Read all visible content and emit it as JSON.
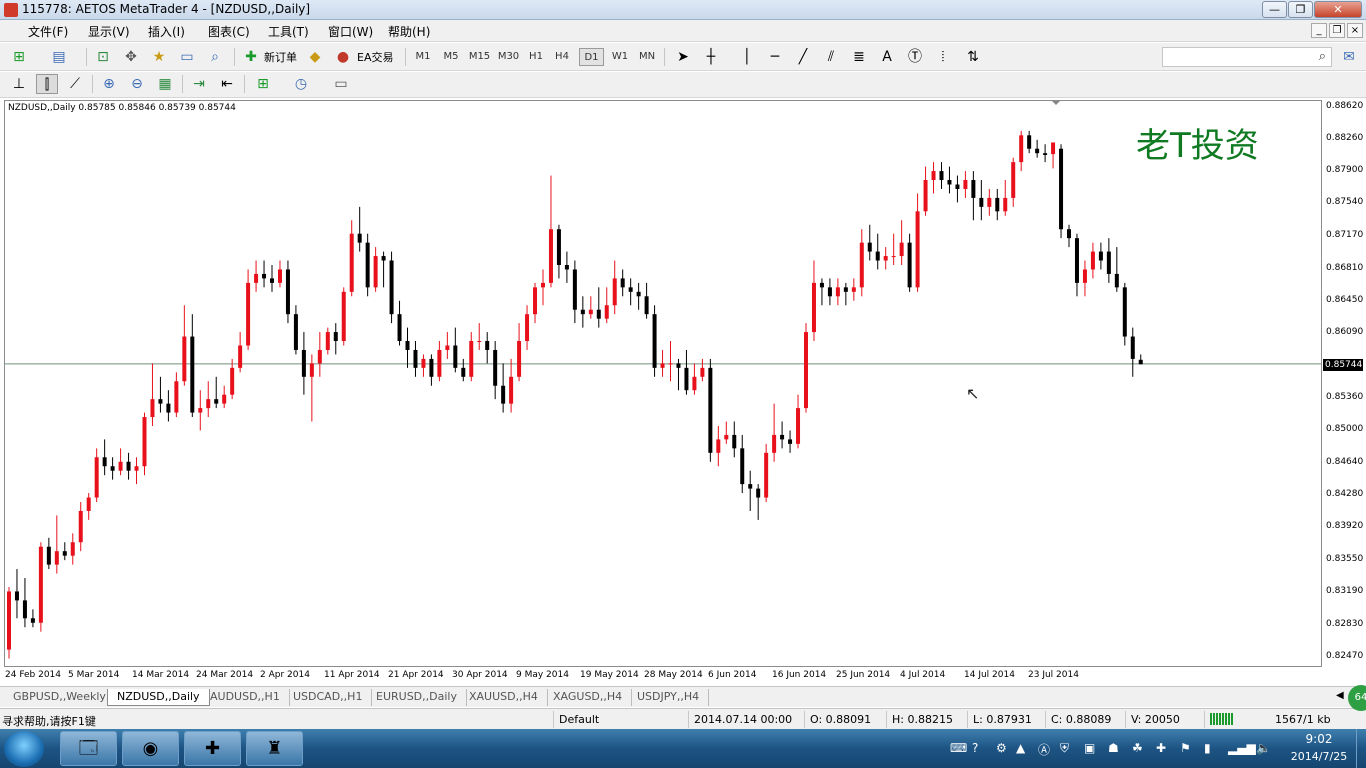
{
  "window": {
    "title": "115778: AETOS MetaTrader 4 - [NZDUSD,,Daily]",
    "min_label": "—",
    "max_label": "❐",
    "close_label": "✕"
  },
  "menu": {
    "items": [
      "文件(F)",
      "显示(V)",
      "插入(I)",
      "图表(C)",
      "工具(T)",
      "窗口(W)",
      "帮助(H)"
    ]
  },
  "toolbar": {
    "new_order_label": "新订单",
    "ea_label": "EA交易",
    "timeframes": [
      "M1",
      "M5",
      "M15",
      "M30",
      "H1",
      "H4",
      "D1",
      "W1",
      "MN"
    ],
    "active_timeframe": "D1"
  },
  "search": {
    "placeholder": ""
  },
  "chart": {
    "header": "NZDUSD,,Daily  0.85785 0.85846 0.85739 0.85744",
    "watermark": "老T投资",
    "current_price_label": "0.85744",
    "price_axis_labels": [
      "0.88620",
      "0.88260",
      "0.87900",
      "0.87540",
      "0.87170",
      "0.86810",
      "0.86450",
      "0.86090",
      "0.85744",
      "0.85360",
      "0.85000",
      "0.84640",
      "0.84280",
      "0.83920",
      "0.83550",
      "0.83190",
      "0.82830",
      "0.82470"
    ],
    "date_axis_labels": [
      "24 Feb 2014",
      "5 Mar 2014",
      "14 Mar 2014",
      "24 Mar 2014",
      "2 Apr 2014",
      "11 Apr 2014",
      "21 Apr 2014",
      "30 Apr 2014",
      "9 May 2014",
      "19 May 2014",
      "28 May 2014",
      "6 Jun 2014",
      "16 Jun 2014",
      "25 Jun 2014",
      "4 Jul 2014",
      "14 Jul 2014",
      "23 Jul 2014"
    ]
  },
  "chart_data": {
    "type": "candlestick",
    "symbol": "NZDUSD,,Daily",
    "up_color": "#e8101a",
    "down_color": "#000000",
    "ylim": [
      0.824,
      0.8865
    ],
    "current_price": 0.85744,
    "candles": [
      [
        0.8255,
        0.832,
        0.8245,
        0.8325
      ],
      [
        0.832,
        0.831,
        0.829,
        0.8345
      ],
      [
        0.831,
        0.829,
        0.828,
        0.8335
      ],
      [
        0.829,
        0.8285,
        0.828,
        0.83
      ],
      [
        0.8285,
        0.837,
        0.8275,
        0.8375
      ],
      [
        0.837,
        0.835,
        0.8345,
        0.838
      ],
      [
        0.835,
        0.8365,
        0.834,
        0.8405
      ],
      [
        0.8365,
        0.836,
        0.8355,
        0.8375
      ],
      [
        0.836,
        0.8375,
        0.835,
        0.8385
      ],
      [
        0.8375,
        0.841,
        0.8365,
        0.842
      ],
      [
        0.841,
        0.8425,
        0.84,
        0.843
      ],
      [
        0.8425,
        0.847,
        0.842,
        0.848
      ],
      [
        0.847,
        0.846,
        0.845,
        0.849
      ],
      [
        0.846,
        0.8455,
        0.8445,
        0.847
      ],
      [
        0.8455,
        0.8465,
        0.845,
        0.848
      ],
      [
        0.8465,
        0.8455,
        0.8445,
        0.8475
      ],
      [
        0.8455,
        0.846,
        0.844,
        0.847
      ],
      [
        0.846,
        0.8515,
        0.845,
        0.852
      ],
      [
        0.8515,
        0.8535,
        0.8505,
        0.8575
      ],
      [
        0.8535,
        0.853,
        0.852,
        0.856
      ],
      [
        0.853,
        0.852,
        0.851,
        0.8545
      ],
      [
        0.852,
        0.8555,
        0.8515,
        0.8565
      ],
      [
        0.8555,
        0.8605,
        0.855,
        0.864
      ],
      [
        0.8605,
        0.852,
        0.8515,
        0.863
      ],
      [
        0.852,
        0.8525,
        0.85,
        0.8545
      ],
      [
        0.8525,
        0.8535,
        0.8515,
        0.8555
      ],
      [
        0.8535,
        0.853,
        0.8525,
        0.856
      ],
      [
        0.853,
        0.854,
        0.8525,
        0.855
      ],
      [
        0.854,
        0.857,
        0.8535,
        0.858
      ],
      [
        0.857,
        0.8595,
        0.8565,
        0.861
      ],
      [
        0.8595,
        0.8665,
        0.859,
        0.868
      ],
      [
        0.8665,
        0.8675,
        0.8655,
        0.869
      ],
      [
        0.8675,
        0.867,
        0.866,
        0.869
      ],
      [
        0.867,
        0.8665,
        0.8655,
        0.8685
      ],
      [
        0.8665,
        0.868,
        0.866,
        0.869
      ],
      [
        0.868,
        0.863,
        0.862,
        0.869
      ],
      [
        0.863,
        0.859,
        0.8585,
        0.864
      ],
      [
        0.859,
        0.856,
        0.854,
        0.861
      ],
      [
        0.856,
        0.8575,
        0.851,
        0.8585
      ],
      [
        0.8575,
        0.859,
        0.856,
        0.861
      ],
      [
        0.859,
        0.861,
        0.8585,
        0.8615
      ],
      [
        0.861,
        0.86,
        0.8585,
        0.862
      ],
      [
        0.86,
        0.8655,
        0.8595,
        0.866
      ],
      [
        0.8655,
        0.872,
        0.865,
        0.8735
      ],
      [
        0.872,
        0.871,
        0.87,
        0.875
      ],
      [
        0.871,
        0.866,
        0.865,
        0.872
      ],
      [
        0.866,
        0.8695,
        0.8655,
        0.8705
      ],
      [
        0.8695,
        0.869,
        0.866,
        0.87
      ],
      [
        0.869,
        0.863,
        0.862,
        0.87
      ],
      [
        0.863,
        0.86,
        0.8595,
        0.8645
      ],
      [
        0.86,
        0.859,
        0.857,
        0.8615
      ],
      [
        0.859,
        0.857,
        0.856,
        0.86
      ],
      [
        0.857,
        0.858,
        0.856,
        0.8585
      ],
      [
        0.858,
        0.856,
        0.855,
        0.8585
      ],
      [
        0.856,
        0.859,
        0.8555,
        0.86
      ],
      [
        0.859,
        0.8595,
        0.858,
        0.861
      ],
      [
        0.8595,
        0.857,
        0.8565,
        0.8615
      ],
      [
        0.857,
        0.856,
        0.8555,
        0.858
      ],
      [
        0.856,
        0.86,
        0.8555,
        0.861
      ],
      [
        0.86,
        0.86,
        0.859,
        0.862
      ],
      [
        0.86,
        0.859,
        0.8575,
        0.861
      ],
      [
        0.859,
        0.855,
        0.8535,
        0.86
      ],
      [
        0.855,
        0.853,
        0.852,
        0.8575
      ],
      [
        0.853,
        0.856,
        0.852,
        0.858
      ],
      [
        0.856,
        0.86,
        0.8555,
        0.862
      ],
      [
        0.86,
        0.863,
        0.859,
        0.864
      ],
      [
        0.863,
        0.866,
        0.862,
        0.8665
      ],
      [
        0.866,
        0.8665,
        0.864,
        0.868
      ],
      [
        0.8665,
        0.8725,
        0.866,
        0.8785
      ],
      [
        0.8725,
        0.8685,
        0.867,
        0.873
      ],
      [
        0.8685,
        0.868,
        0.8665,
        0.87
      ],
      [
        0.868,
        0.8635,
        0.862,
        0.869
      ],
      [
        0.8635,
        0.863,
        0.8615,
        0.865
      ],
      [
        0.863,
        0.8635,
        0.8625,
        0.865
      ],
      [
        0.8635,
        0.8625,
        0.8615,
        0.866
      ],
      [
        0.8625,
        0.864,
        0.862,
        0.866
      ],
      [
        0.864,
        0.867,
        0.863,
        0.869
      ],
      [
        0.867,
        0.866,
        0.865,
        0.868
      ],
      [
        0.866,
        0.8655,
        0.864,
        0.867
      ],
      [
        0.8655,
        0.865,
        0.8635,
        0.8665
      ],
      [
        0.865,
        0.863,
        0.8625,
        0.8665
      ],
      [
        0.863,
        0.857,
        0.856,
        0.864
      ],
      [
        0.857,
        0.8575,
        0.856,
        0.859
      ],
      [
        0.8575,
        0.8575,
        0.8555,
        0.86
      ],
      [
        0.8575,
        0.857,
        0.8545,
        0.858
      ],
      [
        0.857,
        0.8545,
        0.854,
        0.859
      ],
      [
        0.8545,
        0.856,
        0.854,
        0.8575
      ],
      [
        0.856,
        0.857,
        0.8555,
        0.858
      ],
      [
        0.857,
        0.8475,
        0.8465,
        0.858
      ],
      [
        0.8475,
        0.849,
        0.846,
        0.8505
      ],
      [
        0.849,
        0.8495,
        0.8485,
        0.851
      ],
      [
        0.8495,
        0.848,
        0.847,
        0.851
      ],
      [
        0.848,
        0.844,
        0.843,
        0.8495
      ],
      [
        0.844,
        0.8435,
        0.841,
        0.8455
      ],
      [
        0.8435,
        0.8425,
        0.84,
        0.844
      ],
      [
        0.8425,
        0.8475,
        0.842,
        0.8485
      ],
      [
        0.8475,
        0.8495,
        0.8465,
        0.853
      ],
      [
        0.8495,
        0.849,
        0.848,
        0.851
      ],
      [
        0.849,
        0.8485,
        0.8475,
        0.85
      ],
      [
        0.8485,
        0.8525,
        0.848,
        0.854
      ],
      [
        0.8525,
        0.861,
        0.852,
        0.862
      ],
      [
        0.861,
        0.8665,
        0.86,
        0.869
      ],
      [
        0.8665,
        0.866,
        0.864,
        0.867
      ],
      [
        0.866,
        0.865,
        0.864,
        0.867
      ],
      [
        0.865,
        0.866,
        0.864,
        0.867
      ],
      [
        0.866,
        0.8655,
        0.864,
        0.8665
      ],
      [
        0.8655,
        0.866,
        0.8645,
        0.867
      ],
      [
        0.866,
        0.871,
        0.865,
        0.8725
      ],
      [
        0.871,
        0.87,
        0.869,
        0.873
      ],
      [
        0.87,
        0.869,
        0.868,
        0.872
      ],
      [
        0.869,
        0.8695,
        0.868,
        0.8705
      ],
      [
        0.8695,
        0.8695,
        0.8685,
        0.872
      ],
      [
        0.8695,
        0.871,
        0.8685,
        0.8735
      ],
      [
        0.871,
        0.866,
        0.8655,
        0.872
      ],
      [
        0.866,
        0.8745,
        0.8655,
        0.8765
      ],
      [
        0.8745,
        0.878,
        0.874,
        0.8795
      ],
      [
        0.878,
        0.879,
        0.8765,
        0.88
      ],
      [
        0.879,
        0.878,
        0.877,
        0.88
      ],
      [
        0.878,
        0.8775,
        0.8765,
        0.8795
      ],
      [
        0.8775,
        0.877,
        0.8755,
        0.8785
      ],
      [
        0.877,
        0.878,
        0.876,
        0.879
      ],
      [
        0.878,
        0.876,
        0.8735,
        0.879
      ],
      [
        0.876,
        0.875,
        0.8735,
        0.878
      ],
      [
        0.875,
        0.876,
        0.874,
        0.877
      ],
      [
        0.876,
        0.8745,
        0.8735,
        0.877
      ],
      [
        0.8745,
        0.876,
        0.874,
        0.878
      ],
      [
        0.876,
        0.88,
        0.875,
        0.8805
      ],
      [
        0.88,
        0.883,
        0.879,
        0.8835
      ],
      [
        0.883,
        0.8815,
        0.881,
        0.8835
      ],
      [
        0.8815,
        0.881,
        0.8805,
        0.8825
      ],
      [
        0.881,
        0.8808,
        0.88,
        0.882
      ],
      [
        0.8809,
        0.8822,
        0.8793,
        0.8815
      ],
      [
        0.8815,
        0.8725,
        0.8715,
        0.882
      ],
      [
        0.8725,
        0.8715,
        0.8705,
        0.873
      ],
      [
        0.8715,
        0.8665,
        0.865,
        0.872
      ],
      [
        0.8665,
        0.868,
        0.865,
        0.869
      ],
      [
        0.868,
        0.87,
        0.867,
        0.871
      ],
      [
        0.87,
        0.869,
        0.868,
        0.871
      ],
      [
        0.87,
        0.8675,
        0.8665,
        0.8715
      ],
      [
        0.8675,
        0.866,
        0.8655,
        0.8705
      ],
      [
        0.866,
        0.8605,
        0.8595,
        0.8665
      ],
      [
        0.8605,
        0.858,
        0.856,
        0.8615
      ],
      [
        0.8579,
        0.8574,
        0.8574,
        0.8585
      ]
    ]
  },
  "tabs": [
    "GBPUSD,,Weekly",
    "NZDUSD,,Daily",
    "AUDUSD,,H1",
    "USDCAD,,H1",
    "EURUSD,,Daily",
    "XAUUSD,,H4",
    "XAGUSD,,H4",
    "USDJPY,,H4"
  ],
  "active_tab": "NZDUSD,,Daily",
  "status": {
    "help": "寻求帮助,请按F1键",
    "profile": "Default",
    "datetime": "2014.07.14 00:00",
    "open": "O: 0.88091",
    "high": "H: 0.88215",
    "low": "L: 0.87931",
    "close": "C: 0.88089",
    "volume": "V: 20050",
    "traffic": "1567/1 kb"
  },
  "taskbar": {
    "time": "9:02",
    "date": "2014/7/25"
  },
  "colors": {
    "accent_green": "#0f7a22",
    "bull": "#e8101a",
    "bear": "#000000"
  }
}
